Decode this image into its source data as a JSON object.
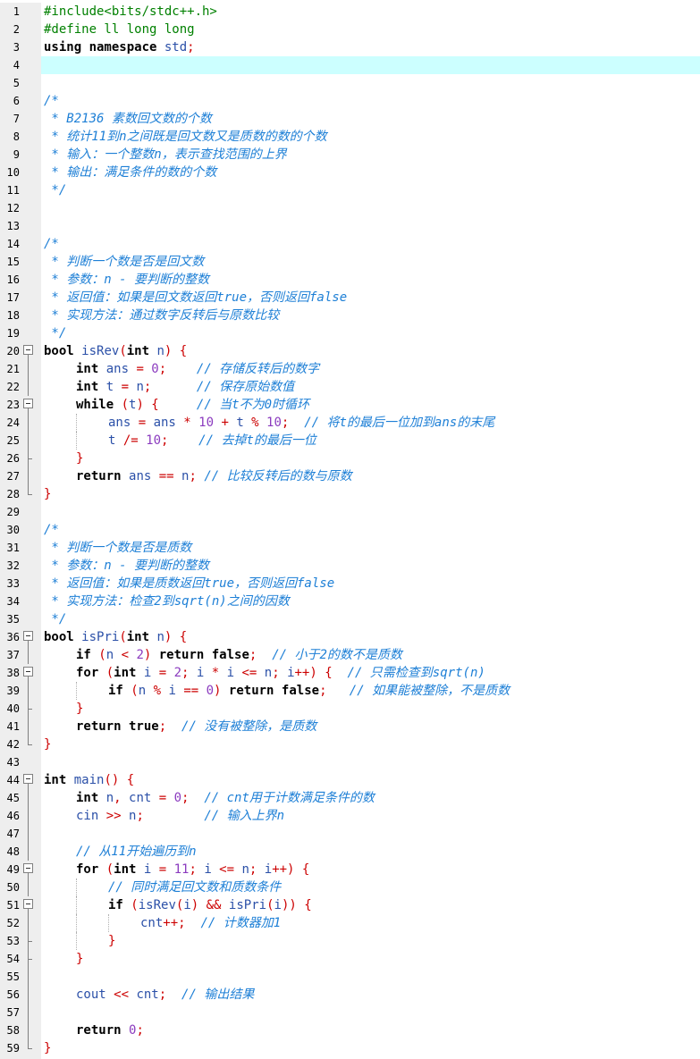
{
  "editor": {
    "current_line": 4,
    "colors": {
      "preprocessor": "#008000",
      "keyword": "#000000",
      "function": "#2b50a8",
      "number": "#8b3bbf",
      "operator": "#cc0000",
      "comment": "#1d7fd6",
      "current_line_bg": "#ccffff",
      "gutter_bg": "#eeeeee"
    },
    "lines": [
      {
        "n": "1",
        "fold": "",
        "indent": 0,
        "tokens": [
          {
            "t": "#include<bits/stdc++.h>",
            "c": "pre"
          }
        ]
      },
      {
        "n": "2",
        "fold": "",
        "indent": 0,
        "tokens": [
          {
            "t": "#define ll long long",
            "c": "pre"
          }
        ]
      },
      {
        "n": "3",
        "fold": "",
        "indent": 0,
        "tokens": [
          {
            "t": "using namespace ",
            "c": "kw"
          },
          {
            "t": "std",
            "c": "fn"
          },
          {
            "t": ";",
            "c": "op"
          }
        ]
      },
      {
        "n": "4",
        "fold": "",
        "indent": 0,
        "tokens": []
      },
      {
        "n": "5",
        "fold": "",
        "indent": 0,
        "tokens": []
      },
      {
        "n": "6",
        "fold": "",
        "indent": 0,
        "tokens": [
          {
            "t": "/*",
            "c": "cm"
          }
        ]
      },
      {
        "n": "7",
        "fold": "",
        "indent": 0,
        "tokens": [
          {
            "t": " * B2136 素数回文数的个数",
            "c": "cm"
          }
        ]
      },
      {
        "n": "8",
        "fold": "",
        "indent": 0,
        "tokens": [
          {
            "t": " * 统计11到n之间既是回文数又是质数的数的个数",
            "c": "cm"
          }
        ]
      },
      {
        "n": "9",
        "fold": "",
        "indent": 0,
        "tokens": [
          {
            "t": " * 输入：一个整数n，表示查找范围的上界",
            "c": "cm"
          }
        ]
      },
      {
        "n": "10",
        "fold": "",
        "indent": 0,
        "tokens": [
          {
            "t": " * 输出：满足条件的数的个数",
            "c": "cm"
          }
        ]
      },
      {
        "n": "11",
        "fold": "",
        "indent": 0,
        "tokens": [
          {
            "t": " */",
            "c": "cm"
          }
        ]
      },
      {
        "n": "12",
        "fold": "",
        "indent": 0,
        "tokens": []
      },
      {
        "n": "13",
        "fold": "",
        "indent": 0,
        "tokens": []
      },
      {
        "n": "14",
        "fold": "",
        "indent": 0,
        "tokens": [
          {
            "t": "/*",
            "c": "cm"
          }
        ]
      },
      {
        "n": "15",
        "fold": "",
        "indent": 0,
        "tokens": [
          {
            "t": " * 判断一个数是否是回文数",
            "c": "cm"
          }
        ]
      },
      {
        "n": "16",
        "fold": "",
        "indent": 0,
        "tokens": [
          {
            "t": " * 参数：n - 要判断的整数",
            "c": "cm"
          }
        ]
      },
      {
        "n": "17",
        "fold": "",
        "indent": 0,
        "tokens": [
          {
            "t": " * 返回值：如果是回文数返回true，否则返回false",
            "c": "cm"
          }
        ]
      },
      {
        "n": "18",
        "fold": "",
        "indent": 0,
        "tokens": [
          {
            "t": " * 实现方法：通过数字反转后与原数比较",
            "c": "cm"
          }
        ]
      },
      {
        "n": "19",
        "fold": "",
        "indent": 0,
        "tokens": [
          {
            "t": " */",
            "c": "cm"
          }
        ]
      },
      {
        "n": "20",
        "fold": "open",
        "indent": 0,
        "tokens": [
          {
            "t": "bool ",
            "c": "kw"
          },
          {
            "t": "isRev",
            "c": "fn"
          },
          {
            "t": "(",
            "c": "op"
          },
          {
            "t": "int ",
            "c": "kw"
          },
          {
            "t": "n",
            "c": "fn"
          },
          {
            "t": ") {",
            "c": "op"
          }
        ]
      },
      {
        "n": "21",
        "fold": "mid",
        "indent": 1,
        "tokens": [
          {
            "t": "int ",
            "c": "kw"
          },
          {
            "t": "ans ",
            "c": "fn"
          },
          {
            "t": "= ",
            "c": "op"
          },
          {
            "t": "0",
            "c": "num"
          },
          {
            "t": ";    ",
            "c": "op"
          },
          {
            "t": "// 存储反转后的数字",
            "c": "cm"
          }
        ]
      },
      {
        "n": "22",
        "fold": "mid",
        "indent": 1,
        "tokens": [
          {
            "t": "int ",
            "c": "kw"
          },
          {
            "t": "t ",
            "c": "fn"
          },
          {
            "t": "= ",
            "c": "op"
          },
          {
            "t": "n",
            "c": "fn"
          },
          {
            "t": ";      ",
            "c": "op"
          },
          {
            "t": "// 保存原始数值",
            "c": "cm"
          }
        ]
      },
      {
        "n": "23",
        "fold": "open",
        "indent": 1,
        "tokens": [
          {
            "t": "while ",
            "c": "kw"
          },
          {
            "t": "(",
            "c": "op"
          },
          {
            "t": "t",
            "c": "fn"
          },
          {
            "t": ") {     ",
            "c": "op"
          },
          {
            "t": "// 当t不为0时循环",
            "c": "cm"
          }
        ]
      },
      {
        "n": "24",
        "fold": "mid",
        "indent": 2,
        "guides": [
          1
        ],
        "tokens": [
          {
            "t": "ans ",
            "c": "fn"
          },
          {
            "t": "= ",
            "c": "op"
          },
          {
            "t": "ans ",
            "c": "fn"
          },
          {
            "t": "* ",
            "c": "op"
          },
          {
            "t": "10 ",
            "c": "num"
          },
          {
            "t": "+ ",
            "c": "op"
          },
          {
            "t": "t ",
            "c": "fn"
          },
          {
            "t": "% ",
            "c": "op"
          },
          {
            "t": "10",
            "c": "num"
          },
          {
            "t": ";  ",
            "c": "op"
          },
          {
            "t": "// 将t的最后一位加到ans的末尾",
            "c": "cm"
          }
        ]
      },
      {
        "n": "25",
        "fold": "mid",
        "indent": 2,
        "guides": [
          1
        ],
        "tokens": [
          {
            "t": "t ",
            "c": "fn"
          },
          {
            "t": "/= ",
            "c": "op"
          },
          {
            "t": "10",
            "c": "num"
          },
          {
            "t": ";    ",
            "c": "op"
          },
          {
            "t": "// 去掉t的最后一位",
            "c": "cm"
          }
        ]
      },
      {
        "n": "26",
        "fold": "close-inner",
        "indent": 1,
        "tokens": [
          {
            "t": "}",
            "c": "op"
          }
        ]
      },
      {
        "n": "27",
        "fold": "mid",
        "indent": 1,
        "tokens": [
          {
            "t": "return ",
            "c": "kw"
          },
          {
            "t": "ans ",
            "c": "fn"
          },
          {
            "t": "== ",
            "c": "op"
          },
          {
            "t": "n",
            "c": "fn"
          },
          {
            "t": "; ",
            "c": "op"
          },
          {
            "t": "// 比较反转后的数与原数",
            "c": "cm"
          }
        ]
      },
      {
        "n": "28",
        "fold": "close",
        "indent": 0,
        "tokens": [
          {
            "t": "}",
            "c": "op"
          }
        ]
      },
      {
        "n": "29",
        "fold": "",
        "indent": 0,
        "tokens": []
      },
      {
        "n": "30",
        "fold": "",
        "indent": 0,
        "tokens": [
          {
            "t": "/*",
            "c": "cm"
          }
        ]
      },
      {
        "n": "31",
        "fold": "",
        "indent": 0,
        "tokens": [
          {
            "t": " * 判断一个数是否是质数",
            "c": "cm"
          }
        ]
      },
      {
        "n": "32",
        "fold": "",
        "indent": 0,
        "tokens": [
          {
            "t": " * 参数：n - 要判断的整数",
            "c": "cm"
          }
        ]
      },
      {
        "n": "33",
        "fold": "",
        "indent": 0,
        "tokens": [
          {
            "t": " * 返回值：如果是质数返回true，否则返回false",
            "c": "cm"
          }
        ]
      },
      {
        "n": "34",
        "fold": "",
        "indent": 0,
        "tokens": [
          {
            "t": " * 实现方法：检查2到sqrt(n)之间的因数",
            "c": "cm"
          }
        ]
      },
      {
        "n": "35",
        "fold": "",
        "indent": 0,
        "tokens": [
          {
            "t": " */",
            "c": "cm"
          }
        ]
      },
      {
        "n": "36",
        "fold": "open",
        "indent": 0,
        "tokens": [
          {
            "t": "bool ",
            "c": "kw"
          },
          {
            "t": "isPri",
            "c": "fn"
          },
          {
            "t": "(",
            "c": "op"
          },
          {
            "t": "int ",
            "c": "kw"
          },
          {
            "t": "n",
            "c": "fn"
          },
          {
            "t": ") {",
            "c": "op"
          }
        ]
      },
      {
        "n": "37",
        "fold": "mid",
        "indent": 1,
        "tokens": [
          {
            "t": "if ",
            "c": "kw"
          },
          {
            "t": "(",
            "c": "op"
          },
          {
            "t": "n ",
            "c": "fn"
          },
          {
            "t": "< ",
            "c": "op"
          },
          {
            "t": "2",
            "c": "num"
          },
          {
            "t": ") ",
            "c": "op"
          },
          {
            "t": "return false",
            "c": "kw"
          },
          {
            "t": ";  ",
            "c": "op"
          },
          {
            "t": "// 小于2的数不是质数",
            "c": "cm"
          }
        ]
      },
      {
        "n": "38",
        "fold": "open",
        "indent": 1,
        "tokens": [
          {
            "t": "for ",
            "c": "kw"
          },
          {
            "t": "(",
            "c": "op"
          },
          {
            "t": "int ",
            "c": "kw"
          },
          {
            "t": "i ",
            "c": "fn"
          },
          {
            "t": "= ",
            "c": "op"
          },
          {
            "t": "2",
            "c": "num"
          },
          {
            "t": "; ",
            "c": "op"
          },
          {
            "t": "i ",
            "c": "fn"
          },
          {
            "t": "* ",
            "c": "op"
          },
          {
            "t": "i ",
            "c": "fn"
          },
          {
            "t": "<= ",
            "c": "op"
          },
          {
            "t": "n",
            "c": "fn"
          },
          {
            "t": "; ",
            "c": "op"
          },
          {
            "t": "i",
            "c": "fn"
          },
          {
            "t": "++) {  ",
            "c": "op"
          },
          {
            "t": "// 只需检查到sqrt(n)",
            "c": "cm"
          }
        ]
      },
      {
        "n": "39",
        "fold": "mid",
        "indent": 2,
        "guides": [
          1
        ],
        "tokens": [
          {
            "t": "if ",
            "c": "kw"
          },
          {
            "t": "(",
            "c": "op"
          },
          {
            "t": "n ",
            "c": "fn"
          },
          {
            "t": "% ",
            "c": "op"
          },
          {
            "t": "i ",
            "c": "fn"
          },
          {
            "t": "== ",
            "c": "op"
          },
          {
            "t": "0",
            "c": "num"
          },
          {
            "t": ") ",
            "c": "op"
          },
          {
            "t": "return false",
            "c": "kw"
          },
          {
            "t": ";   ",
            "c": "op"
          },
          {
            "t": "// 如果能被整除，不是质数",
            "c": "cm"
          }
        ]
      },
      {
        "n": "40",
        "fold": "close-inner",
        "indent": 1,
        "tokens": [
          {
            "t": "}",
            "c": "op"
          }
        ]
      },
      {
        "n": "41",
        "fold": "mid",
        "indent": 1,
        "tokens": [
          {
            "t": "return true",
            "c": "kw"
          },
          {
            "t": ";  ",
            "c": "op"
          },
          {
            "t": "// 没有被整除，是质数",
            "c": "cm"
          }
        ]
      },
      {
        "n": "42",
        "fold": "close",
        "indent": 0,
        "tokens": [
          {
            "t": "}",
            "c": "op"
          }
        ]
      },
      {
        "n": "43",
        "fold": "",
        "indent": 0,
        "tokens": []
      },
      {
        "n": "44",
        "fold": "open",
        "indent": 0,
        "tokens": [
          {
            "t": "int ",
            "c": "kw"
          },
          {
            "t": "main",
            "c": "fn"
          },
          {
            "t": "() {",
            "c": "op"
          }
        ]
      },
      {
        "n": "45",
        "fold": "mid",
        "indent": 1,
        "tokens": [
          {
            "t": "int ",
            "c": "kw"
          },
          {
            "t": "n",
            "c": "fn"
          },
          {
            "t": ", ",
            "c": "op"
          },
          {
            "t": "cnt ",
            "c": "fn"
          },
          {
            "t": "= ",
            "c": "op"
          },
          {
            "t": "0",
            "c": "num"
          },
          {
            "t": ";  ",
            "c": "op"
          },
          {
            "t": "// cnt用于计数满足条件的数",
            "c": "cm"
          }
        ]
      },
      {
        "n": "46",
        "fold": "mid",
        "indent": 1,
        "tokens": [
          {
            "t": "cin ",
            "c": "fn"
          },
          {
            "t": ">> ",
            "c": "op"
          },
          {
            "t": "n",
            "c": "fn"
          },
          {
            "t": ";        ",
            "c": "op"
          },
          {
            "t": "// 输入上界n",
            "c": "cm"
          }
        ]
      },
      {
        "n": "47",
        "fold": "mid",
        "indent": 0,
        "tokens": []
      },
      {
        "n": "48",
        "fold": "mid",
        "indent": 1,
        "tokens": [
          {
            "t": "// 从11开始遍历到n",
            "c": "cm"
          }
        ]
      },
      {
        "n": "49",
        "fold": "open",
        "indent": 1,
        "tokens": [
          {
            "t": "for ",
            "c": "kw"
          },
          {
            "t": "(",
            "c": "op"
          },
          {
            "t": "int ",
            "c": "kw"
          },
          {
            "t": "i ",
            "c": "fn"
          },
          {
            "t": "= ",
            "c": "op"
          },
          {
            "t": "11",
            "c": "num"
          },
          {
            "t": "; ",
            "c": "op"
          },
          {
            "t": "i ",
            "c": "fn"
          },
          {
            "t": "<= ",
            "c": "op"
          },
          {
            "t": "n",
            "c": "fn"
          },
          {
            "t": "; ",
            "c": "op"
          },
          {
            "t": "i",
            "c": "fn"
          },
          {
            "t": "++) {",
            "c": "op"
          }
        ]
      },
      {
        "n": "50",
        "fold": "mid",
        "indent": 2,
        "guides": [
          1
        ],
        "tokens": [
          {
            "t": "// 同时满足回文数和质数条件",
            "c": "cm"
          }
        ]
      },
      {
        "n": "51",
        "fold": "open",
        "indent": 2,
        "guides": [
          1
        ],
        "tokens": [
          {
            "t": "if ",
            "c": "kw"
          },
          {
            "t": "(",
            "c": "op"
          },
          {
            "t": "isRev",
            "c": "fn"
          },
          {
            "t": "(",
            "c": "op"
          },
          {
            "t": "i",
            "c": "fn"
          },
          {
            "t": ") && ",
            "c": "op"
          },
          {
            "t": "isPri",
            "c": "fn"
          },
          {
            "t": "(",
            "c": "op"
          },
          {
            "t": "i",
            "c": "fn"
          },
          {
            "t": ")) {",
            "c": "op"
          }
        ]
      },
      {
        "n": "52",
        "fold": "mid",
        "indent": 3,
        "guides": [
          1,
          2
        ],
        "tokens": [
          {
            "t": "cnt",
            "c": "fn"
          },
          {
            "t": "++;  ",
            "c": "op"
          },
          {
            "t": "// 计数器加1",
            "c": "cm"
          }
        ]
      },
      {
        "n": "53",
        "fold": "close-inner",
        "indent": 2,
        "guides": [
          1
        ],
        "tokens": [
          {
            "t": "}",
            "c": "op"
          }
        ]
      },
      {
        "n": "54",
        "fold": "close-inner",
        "indent": 1,
        "tokens": [
          {
            "t": "}",
            "c": "op"
          }
        ]
      },
      {
        "n": "55",
        "fold": "mid",
        "indent": 0,
        "tokens": []
      },
      {
        "n": "56",
        "fold": "mid",
        "indent": 1,
        "tokens": [
          {
            "t": "cout ",
            "c": "fn"
          },
          {
            "t": "<< ",
            "c": "op"
          },
          {
            "t": "cnt",
            "c": "fn"
          },
          {
            "t": ";  ",
            "c": "op"
          },
          {
            "t": "// 输出结果",
            "c": "cm"
          }
        ]
      },
      {
        "n": "57",
        "fold": "mid",
        "indent": 0,
        "tokens": []
      },
      {
        "n": "58",
        "fold": "mid",
        "indent": 1,
        "tokens": [
          {
            "t": "return ",
            "c": "kw"
          },
          {
            "t": "0",
            "c": "num"
          },
          {
            "t": ";",
            "c": "op"
          }
        ]
      },
      {
        "n": "59",
        "fold": "close",
        "indent": 0,
        "tokens": [
          {
            "t": "}",
            "c": "op"
          }
        ]
      }
    ]
  }
}
